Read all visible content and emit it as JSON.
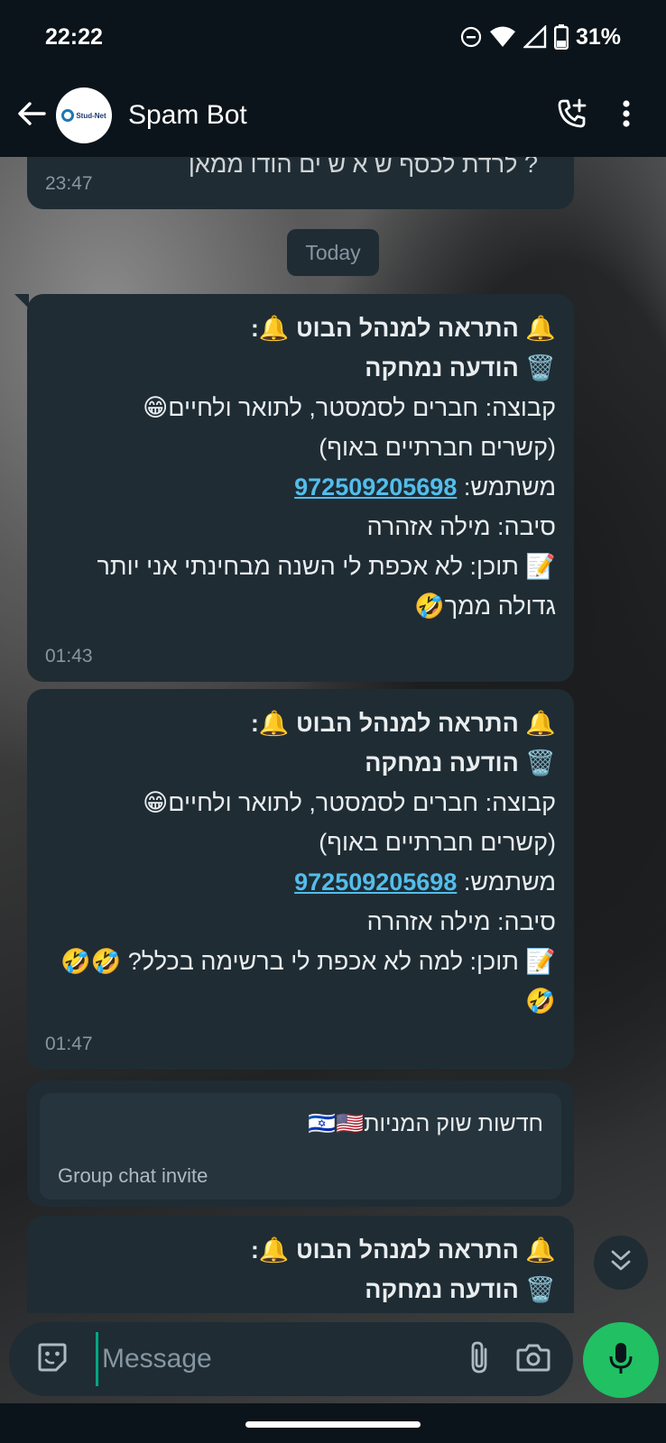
{
  "status_bar": {
    "time": "22:22",
    "battery": "31%",
    "icons": [
      "do-not-disturb-icon",
      "wifi-icon",
      "cellular-signal-icon",
      "battery-icon"
    ]
  },
  "header": {
    "chat_name": "Spam Bot",
    "avatar_text": "Stud-Net",
    "icons": [
      "back-arrow-icon",
      "add-call-icon",
      "more-vert-icon"
    ]
  },
  "chat": {
    "previous_message": {
      "text": "? לרדת לכסף ש א ש ים הודו ממאן",
      "time": "23:47"
    },
    "date_chip": "Today",
    "messages": [
      {
        "line1": "🔔 התראה למנהל הבוט 🔔:",
        "line2": "🗑️ הודעה נמחקה",
        "line3": "קבוצה: חברים לסמסטר, לתואר ולחיים😁",
        "line4": "(קשרים חברתיים באוף)",
        "user_label": "משתמש: ",
        "user_phone": "972509205698",
        "reason": "סיבה: מילה אזהרה",
        "content": "📝 תוכן: לא אכפת לי השנה מבחינתי אני יותר גדולה ממך🤣",
        "time": "01:43"
      },
      {
        "line1": "🔔 התראה למנהל הבוט 🔔:",
        "line2": "🗑️ הודעה נמחקה",
        "line3": "קבוצה: חברים לסמסטר, לתואר ולחיים😁",
        "line4": "(קשרים חברתיים באוף)",
        "user_label": "משתמש: ",
        "user_phone": "972509205698",
        "reason": "סיבה: מילה אזהרה",
        "content": "📝 תוכן: למה לא אכפת לי ברשימה בכלל? 🤣🤣🤣",
        "time": "01:47"
      }
    ],
    "invite": {
      "title": "חדשות שוק המניות🇮🇱🇺🇸",
      "subtitle": "Group chat invite"
    },
    "last_message": {
      "line1": "🔔 התראה למנהל הבוט 🔔:",
      "line2": "🗑️ הודעה נמחקה"
    }
  },
  "input": {
    "placeholder": "Message",
    "icons": [
      "sticker-icon",
      "attach-icon",
      "camera-icon",
      "mic-icon",
      "scroll-down-icon"
    ]
  },
  "colors": {
    "bubble": "#1f2c34",
    "link": "#53bdeb",
    "accent": "#21c063",
    "timestamp": "#8696a0"
  }
}
